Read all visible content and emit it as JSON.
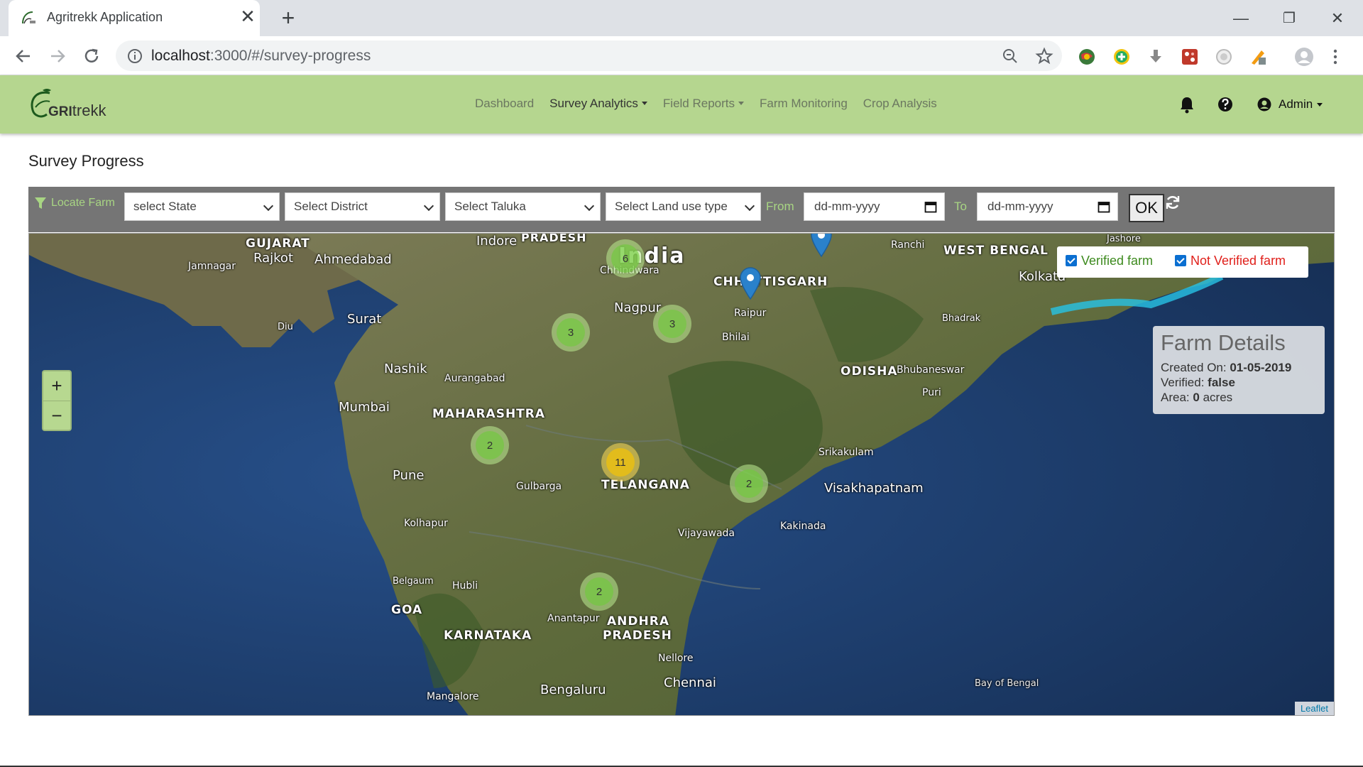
{
  "browser": {
    "tab_title": "Agritrekk Application",
    "tab_close": "✕",
    "new_tab": "+",
    "url_host": "localhost",
    "url_path": ":3000/#/survey-progress",
    "minimize": "—",
    "restore": "❐",
    "close": "✕"
  },
  "app": {
    "logo_prefix": "GRI",
    "logo_suffix": "trekk",
    "nav": [
      {
        "label": "Dashboard",
        "dropdown": false,
        "active": false
      },
      {
        "label": "Survey Analytics",
        "dropdown": true,
        "active": true
      },
      {
        "label": "Field Reports",
        "dropdown": true,
        "active": false
      },
      {
        "label": "Farm Monitoring",
        "dropdown": false,
        "active": false
      },
      {
        "label": "Crop Analysis",
        "dropdown": false,
        "active": false
      }
    ],
    "user_label": "Admin"
  },
  "page": {
    "title": "Survey Progress"
  },
  "filters": {
    "locate_label": "Locate Farm",
    "state_placeholder": "select State",
    "district_placeholder": "Select District",
    "taluka_placeholder": "Select Taluka",
    "landuse_placeholder": "Select Land use type",
    "from_label": "From",
    "to_label": "To",
    "date_placeholder": "dd-mm-yyyy",
    "ok_label": "OK"
  },
  "map": {
    "labels": [
      {
        "text": "GUJARAT",
        "kind": "state"
      },
      {
        "text": "Rajkot",
        "kind": "city"
      },
      {
        "text": "Ahmedabad",
        "kind": "city"
      },
      {
        "text": "Jamnagar",
        "kind": "city"
      },
      {
        "text": "Indore",
        "kind": "city"
      },
      {
        "text": "PRADESH",
        "kind": "state"
      },
      {
        "text": "India",
        "kind": "country"
      },
      {
        "text": "Chhindwara",
        "kind": "city"
      },
      {
        "text": "Ranchi",
        "kind": "city"
      },
      {
        "text": "WEST BENGAL",
        "kind": "state"
      },
      {
        "text": "Jashore",
        "kind": "city"
      },
      {
        "text": "CHHATTISGARH",
        "kind": "state"
      },
      {
        "text": "Kolkata",
        "kind": "city"
      },
      {
        "text": "Surat",
        "kind": "city"
      },
      {
        "text": "Diu",
        "kind": "city"
      },
      {
        "text": "Nagpur",
        "kind": "city"
      },
      {
        "text": "Raipur",
        "kind": "city"
      },
      {
        "text": "Bhilai",
        "kind": "city"
      },
      {
        "text": "Bhadrak",
        "kind": "city"
      },
      {
        "text": "Nashik",
        "kind": "city"
      },
      {
        "text": "Aurangabad",
        "kind": "city"
      },
      {
        "text": "ODISHA",
        "kind": "state"
      },
      {
        "text": "Bhubaneswar",
        "kind": "city"
      },
      {
        "text": "Puri",
        "kind": "city"
      },
      {
        "text": "Mumbai",
        "kind": "city"
      },
      {
        "text": "MAHARASHTRA",
        "kind": "state"
      },
      {
        "text": "Srikakulam",
        "kind": "city"
      },
      {
        "text": "Pune",
        "kind": "city"
      },
      {
        "text": "Gulbarga",
        "kind": "city"
      },
      {
        "text": "TELANGANA",
        "kind": "state"
      },
      {
        "text": "Visakhapatnam",
        "kind": "city"
      },
      {
        "text": "Kolhapur",
        "kind": "city"
      },
      {
        "text": "Kakinada",
        "kind": "city"
      },
      {
        "text": "Vijayawada",
        "kind": "city"
      },
      {
        "text": "Belgaum",
        "kind": "city"
      },
      {
        "text": "Hubli",
        "kind": "city"
      },
      {
        "text": "GOA",
        "kind": "state"
      },
      {
        "text": "Anantapur",
        "kind": "city"
      },
      {
        "text": "ANDHRA",
        "kind": "state"
      },
      {
        "text": "KARNATAKA",
        "kind": "state"
      },
      {
        "text": "PRADESH",
        "kind": "state"
      },
      {
        "text": "Nellore",
        "kind": "city"
      },
      {
        "text": "Chennai",
        "kind": "city"
      },
      {
        "text": "Bengaluru",
        "kind": "city"
      },
      {
        "text": "Mangalore",
        "kind": "city"
      },
      {
        "text": "Bay of Bengal",
        "kind": "sea"
      }
    ],
    "clusters": [
      {
        "count": "6",
        "color": "green"
      },
      {
        "count": "3",
        "color": "green"
      },
      {
        "count": "3",
        "color": "green"
      },
      {
        "count": "2",
        "color": "green"
      },
      {
        "count": "11",
        "color": "yellow"
      },
      {
        "count": "2",
        "color": "green"
      },
      {
        "count": "2",
        "color": "green"
      }
    ],
    "zoom_in": "+",
    "zoom_out": "−",
    "layers": {
      "verified": "Verified farm",
      "not_verified": "Not Verified farm",
      "verified_color": "#3d8a1e",
      "not_verified_color": "#e0201b"
    },
    "details": {
      "title": "Farm Details",
      "created_label": "Created On:",
      "created_value": "01-05-2019",
      "verified_label": "Verified:",
      "verified_value": "false",
      "area_label": "Area:",
      "area_value": "0",
      "area_unit": "acres"
    },
    "attribution": "Leaflet"
  },
  "colors": {
    "navbar": "#b5d68f",
    "filterbar": "#757575",
    "accent_green": "#a8d583"
  }
}
